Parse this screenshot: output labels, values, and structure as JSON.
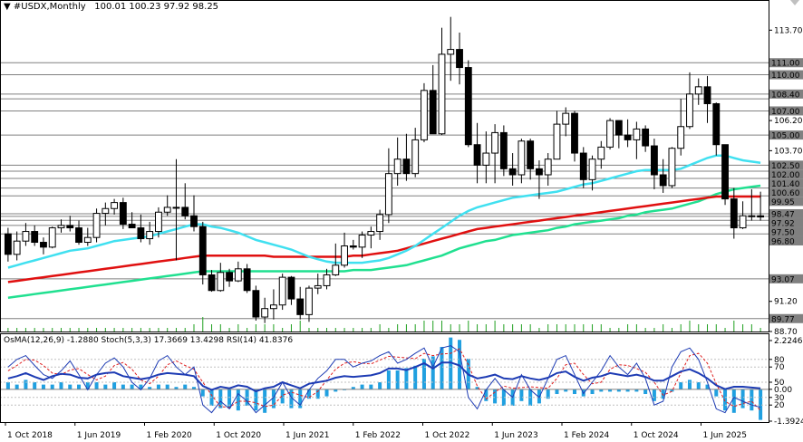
{
  "header": {
    "symbol": "#USDX,Monthly",
    "ohlc": "100.01 100.23 97.92 98.25"
  },
  "indicator_header": "OsMA(12,26,9) -1.2880  Stoch(5,3,3) 17.3669 13.4298  RSI(14) 41.8376",
  "colors": {
    "bull": "#000000",
    "bear": "#000000",
    "ma_fast": "#40e0f0",
    "ma_mid": "#20e090",
    "ma_slow": "#e01010",
    "volume": "#20a020",
    "osma": "#20a0e0",
    "stoch_main": "#1e3cb4",
    "stoch_signal": "#e02020",
    "rsi": "#1e3cb4",
    "level_line": "#808080",
    "tag_bg": "#808080",
    "tag_text": "#ffffff"
  },
  "chart_data": {
    "type": "candlestick",
    "price_axis": {
      "min": 88.7,
      "max": 115.0,
      "ticks": [
        "113.70",
        "106.20",
        "103.70",
        "96.20",
        "91.20",
        "88.70"
      ]
    },
    "price_tags": [
      "111.00",
      "110.00",
      "108.40",
      "107.00",
      "105.00",
      "102.50",
      "102.00",
      "101.40",
      "100.60",
      "99.95",
      "98.47",
      "97.92",
      "97.50",
      "96.80",
      "93.07",
      "89.77"
    ],
    "level_lines": [
      111.0,
      110.0,
      108.4,
      108.0,
      107.0,
      105.0,
      102.5,
      102.0,
      101.4,
      100.6,
      99.95,
      98.47,
      98.25,
      97.92,
      97.5,
      96.8,
      93.07,
      89.77
    ],
    "indicator_axis": {
      "ticks": [
        "2.2246",
        "80",
        "70",
        "50",
        "0.00",
        "30",
        "20",
        "-1.3924"
      ]
    },
    "x_labels": [
      "1 Oct 2018",
      "1 Jun 2019",
      "1 Feb 2020",
      "1 Oct 2020",
      "1 Jun 2021",
      "1 Feb 2022",
      "1 Oct 2022",
      "1 Jun 2023",
      "1 Feb 2024",
      "1 Oct 2024",
      "1 Jun 2025"
    ],
    "candles": [
      [
        96.8,
        97.3,
        94.5,
        95.1
      ],
      [
        95.1,
        97.0,
        94.6,
        96.2
      ],
      [
        96.2,
        97.7,
        95.8,
        97.0
      ],
      [
        97.0,
        97.5,
        95.8,
        96.1
      ],
      [
        96.1,
        96.5,
        95.1,
        95.7
      ],
      [
        95.7,
        97.4,
        95.6,
        97.3
      ],
      [
        97.3,
        98.0,
        96.9,
        97.5
      ],
      [
        97.5,
        98.3,
        97.0,
        97.3
      ],
      [
        97.3,
        97.9,
        95.9,
        96.1
      ],
      [
        96.1,
        97.3,
        95.8,
        96.5
      ],
      [
        96.5,
        98.9,
        96.1,
        98.5
      ],
      [
        98.5,
        99.4,
        97.5,
        98.9
      ],
      [
        98.9,
        99.7,
        98.4,
        99.4
      ],
      [
        99.4,
        99.8,
        97.2,
        97.6
      ],
      [
        97.6,
        98.6,
        97.4,
        97.3
      ],
      [
        97.3,
        98.4,
        96.1,
        96.4
      ],
      [
        96.4,
        97.8,
        95.9,
        97.0
      ],
      [
        97.0,
        99.0,
        96.5,
        98.6
      ],
      [
        98.6,
        100.0,
        98.3,
        99.0
      ],
      [
        99.0,
        103.0,
        94.6,
        99.0
      ],
      [
        99.0,
        101.0,
        98.0,
        98.3
      ],
      [
        98.3,
        100.0,
        97.0,
        97.4
      ],
      [
        97.4,
        97.8,
        92.6,
        93.4
      ],
      [
        93.4,
        93.8,
        92.0,
        92.1
      ],
      [
        92.1,
        94.4,
        92.0,
        93.6
      ],
      [
        93.6,
        93.9,
        92.4,
        92.9
      ],
      [
        92.9,
        94.5,
        92.8,
        93.9
      ],
      [
        93.9,
        94.3,
        91.9,
        92.1
      ],
      [
        92.1,
        92.5,
        89.6,
        89.9
      ],
      [
        89.9,
        91.5,
        89.4,
        90.6
      ],
      [
        90.6,
        92.2,
        89.7,
        90.9
      ],
      [
        90.9,
        93.5,
        90.5,
        93.2
      ],
      [
        93.2,
        93.3,
        90.9,
        91.4
      ],
      [
        91.4,
        92.4,
        89.7,
        90.1
      ],
      [
        90.1,
        92.5,
        89.5,
        92.3
      ],
      [
        92.3,
        93.5,
        91.8,
        92.5
      ],
      [
        92.5,
        93.9,
        92.2,
        93.4
      ],
      [
        93.4,
        96.0,
        93.3,
        94.2
      ],
      [
        94.2,
        96.9,
        94.0,
        95.8
      ],
      [
        95.8,
        96.3,
        95.5,
        95.7
      ],
      [
        95.7,
        97.0,
        94.8,
        96.7
      ],
      [
        96.7,
        97.4,
        95.6,
        97.0
      ],
      [
        97.0,
        98.8,
        96.3,
        98.4
      ],
      [
        98.4,
        103.9,
        97.7,
        101.8
      ],
      [
        101.8,
        104.8,
        100.8,
        103.0
      ],
      [
        103.0,
        105.1,
        101.2,
        101.8
      ],
      [
        101.8,
        105.6,
        101.5,
        104.6
      ],
      [
        104.6,
        109.3,
        104.4,
        108.7
      ],
      [
        108.7,
        110.8,
        105.5,
        105.1
      ],
      [
        105.1,
        113.9,
        105.0,
        111.7
      ],
      [
        111.7,
        114.8,
        109.5,
        112.1
      ],
      [
        112.1,
        113.5,
        109.2,
        110.6
      ],
      [
        110.6,
        111.2,
        104.0,
        104.2
      ],
      [
        104.2,
        106.0,
        101.0,
        102.5
      ],
      [
        102.5,
        105.3,
        101.0,
        103.5
      ],
      [
        103.5,
        105.9,
        101.0,
        105.2
      ],
      [
        105.2,
        105.8,
        101.6,
        102.2
      ],
      [
        102.2,
        103.5,
        100.8,
        101.7
      ],
      [
        101.7,
        104.7,
        101.0,
        104.5
      ],
      [
        104.5,
        104.7,
        101.3,
        102.2
      ],
      [
        102.2,
        102.9,
        99.7,
        101.7
      ],
      [
        101.7,
        103.5,
        100.8,
        103.0
      ],
      [
        103.0,
        107.0,
        103.0,
        105.9
      ],
      [
        105.9,
        107.3,
        104.9,
        106.8
      ],
      [
        106.8,
        107.0,
        102.8,
        103.5
      ],
      [
        103.5,
        104.0,
        100.6,
        101.3
      ],
      [
        101.3,
        103.3,
        100.4,
        103.0
      ],
      [
        103.0,
        104.5,
        102.2,
        104.0
      ],
      [
        104.0,
        106.4,
        103.8,
        106.2
      ],
      [
        106.2,
        106.0,
        103.9,
        105.0
      ],
      [
        105.0,
        106.3,
        104.0,
        104.6
      ],
      [
        104.6,
        106.1,
        103.0,
        105.5
      ],
      [
        105.5,
        105.8,
        103.6,
        104.1
      ],
      [
        104.1,
        104.7,
        100.5,
        101.7
      ],
      [
        101.7,
        103.0,
        100.2,
        100.8
      ],
      [
        100.8,
        104.0,
        100.6,
        103.9
      ],
      [
        103.9,
        108.0,
        103.3,
        105.7
      ],
      [
        105.7,
        110.2,
        105.5,
        108.4
      ],
      [
        108.4,
        109.7,
        107.5,
        109.0
      ],
      [
        109.0,
        109.9,
        106.0,
        107.6
      ],
      [
        107.6,
        107.7,
        103.3,
        104.2
      ],
      [
        104.2,
        104.2,
        99.2,
        99.7
      ],
      [
        99.7,
        100.6,
        96.4,
        97.3
      ],
      [
        97.3,
        99.5,
        97.2,
        98.3
      ],
      [
        98.3,
        100.5,
        97.9,
        98.3
      ],
      [
        98.3,
        100.3,
        97.9,
        98.2
      ]
    ],
    "ma_fast": [
      94.0,
      94.2,
      94.4,
      94.6,
      94.8,
      95.0,
      95.2,
      95.4,
      95.5,
      95.6,
      95.8,
      96.0,
      96.2,
      96.3,
      96.4,
      96.5,
      96.6,
      96.8,
      97.0,
      97.2,
      97.4,
      97.6,
      97.6,
      97.4,
      97.3,
      97.1,
      96.9,
      96.6,
      96.3,
      96.1,
      95.9,
      95.7,
      95.5,
      95.2,
      94.9,
      94.7,
      94.5,
      94.4,
      94.4,
      94.4,
      94.4,
      94.5,
      94.6,
      94.8,
      95.1,
      95.4,
      95.8,
      96.3,
      96.8,
      97.3,
      97.8,
      98.3,
      98.7,
      99.0,
      99.2,
      99.4,
      99.6,
      99.8,
      99.9,
      100.0,
      100.1,
      100.2,
      100.3,
      100.5,
      100.7,
      100.9,
      101.0,
      101.2,
      101.4,
      101.6,
      101.8,
      102.0,
      102.1,
      102.1,
      102.1,
      102.1,
      102.2,
      102.5,
      102.8,
      103.1,
      103.3,
      103.3,
      103.1,
      102.9,
      102.8,
      102.7
    ],
    "ma_mid": [
      91.5,
      91.6,
      91.7,
      91.8,
      91.9,
      92.0,
      92.1,
      92.2,
      92.3,
      92.4,
      92.5,
      92.6,
      92.7,
      92.8,
      92.9,
      93.0,
      93.1,
      93.2,
      93.3,
      93.4,
      93.5,
      93.6,
      93.7,
      93.7,
      93.7,
      93.7,
      93.7,
      93.7,
      93.7,
      93.7,
      93.7,
      93.7,
      93.7,
      93.7,
      93.7,
      93.7,
      93.7,
      93.7,
      93.7,
      93.8,
      93.8,
      93.8,
      93.9,
      94.0,
      94.1,
      94.2,
      94.4,
      94.6,
      94.8,
      95.0,
      95.3,
      95.6,
      95.8,
      96.0,
      96.2,
      96.3,
      96.5,
      96.7,
      96.8,
      96.9,
      97.0,
      97.1,
      97.3,
      97.4,
      97.6,
      97.7,
      97.8,
      97.9,
      98.0,
      98.1,
      98.3,
      98.4,
      98.6,
      98.7,
      98.8,
      98.9,
      99.1,
      99.3,
      99.5,
      99.8,
      100.1,
      100.3,
      100.5,
      100.6,
      100.7,
      100.8
    ],
    "ma_slow": [
      92.8,
      92.9,
      93.0,
      93.1,
      93.2,
      93.3,
      93.4,
      93.5,
      93.6,
      93.7,
      93.8,
      93.9,
      94.0,
      94.1,
      94.2,
      94.3,
      94.4,
      94.5,
      94.6,
      94.7,
      94.8,
      94.9,
      95.0,
      95.0,
      95.0,
      95.0,
      95.0,
      95.0,
      95.0,
      95.0,
      94.9,
      94.9,
      94.9,
      94.9,
      94.9,
      94.9,
      94.9,
      94.9,
      94.9,
      95.0,
      95.0,
      95.1,
      95.2,
      95.3,
      95.4,
      95.6,
      95.8,
      96.0,
      96.2,
      96.4,
      96.6,
      96.8,
      97.0,
      97.2,
      97.3,
      97.4,
      97.5,
      97.6,
      97.7,
      97.8,
      97.9,
      98.0,
      98.1,
      98.2,
      98.3,
      98.4,
      98.5,
      98.6,
      98.7,
      98.8,
      98.9,
      99.0,
      99.1,
      99.2,
      99.3,
      99.4,
      99.5,
      99.6,
      99.7,
      99.8,
      99.9,
      99.9,
      99.9,
      99.9,
      99.9,
      99.9
    ],
    "volume": [
      1,
      1,
      1,
      1,
      1,
      1,
      1,
      1,
      1,
      1,
      1,
      1,
      1,
      1,
      1,
      1,
      1,
      1,
      1,
      1,
      1,
      2,
      4,
      2,
      2,
      1,
      2,
      1,
      2,
      2,
      2,
      1,
      2,
      3,
      1,
      1,
      1,
      1,
      1,
      1,
      1,
      1,
      2,
      1,
      2,
      2,
      2,
      3,
      3,
      3,
      2,
      2,
      3,
      2,
      2,
      3,
      2,
      2,
      2,
      2,
      1,
      2,
      2,
      2,
      2,
      2,
      2,
      2,
      1,
      1,
      2,
      2,
      1,
      1,
      2,
      1,
      2,
      3,
      2,
      2,
      2,
      1,
      3,
      2,
      2,
      1
    ],
    "osma": [
      0.3,
      0.2,
      0.4,
      0.3,
      0.2,
      0.2,
      0.3,
      0.2,
      0.2,
      0.3,
      0.3,
      0.2,
      0.3,
      0.2,
      0.2,
      0.2,
      0.1,
      0.2,
      0.2,
      0.1,
      0.2,
      0.1,
      -0.3,
      -0.7,
      -0.8,
      -0.8,
      -0.9,
      -0.7,
      -0.9,
      -1.0,
      -0.8,
      -0.6,
      -0.8,
      -0.8,
      -0.4,
      -0.4,
      -0.3,
      -0.1,
      0.0,
      0.1,
      0.2,
      0.2,
      0.3,
      0.8,
      0.8,
      0.9,
      1.0,
      1.3,
      1.4,
      1.8,
      2.2,
      2.1,
      1.3,
      0.1,
      -0.5,
      -0.6,
      -0.7,
      -0.7,
      -0.5,
      -0.7,
      -0.6,
      -0.4,
      -0.2,
      -0.1,
      -0.2,
      -0.3,
      -0.2,
      -0.1,
      -0.1,
      -0.1,
      -0.1,
      -0.1,
      -0.2,
      -0.5,
      -0.4,
      -0.1,
      0.3,
      0.4,
      0.3,
      0.2,
      -0.3,
      -0.9,
      -1.0,
      -0.8,
      -0.9,
      -1.3
    ],
    "stoch_main": [
      70,
      80,
      85,
      72,
      60,
      55,
      65,
      78,
      60,
      40,
      60,
      75,
      82,
      70,
      50,
      40,
      55,
      78,
      85,
      70,
      60,
      70,
      20,
      10,
      25,
      15,
      35,
      25,
      10,
      20,
      30,
      50,
      30,
      20,
      40,
      55,
      65,
      80,
      80,
      70,
      75,
      78,
      85,
      90,
      75,
      80,
      88,
      95,
      70,
      95,
      98,
      90,
      30,
      15,
      40,
      55,
      40,
      30,
      60,
      40,
      30,
      55,
      80,
      85,
      60,
      35,
      50,
      65,
      85,
      70,
      60,
      75,
      55,
      20,
      25,
      70,
      90,
      95,
      80,
      50,
      15,
      10,
      30,
      25,
      20,
      17
    ],
    "stoch_signal": [
      65,
      72,
      80,
      79,
      72,
      62,
      60,
      66,
      68,
      60,
      53,
      58,
      72,
      76,
      67,
      53,
      48,
      58,
      73,
      78,
      72,
      67,
      50,
      33,
      18,
      17,
      25,
      25,
      23,
      18,
      20,
      33,
      37,
      33,
      30,
      38,
      53,
      67,
      75,
      77,
      75,
      74,
      79,
      84,
      83,
      82,
      81,
      88,
      85,
      87,
      88,
      94,
      73,
      45,
      28,
      37,
      45,
      42,
      43,
      44,
      43,
      42,
      55,
      73,
      75,
      60,
      48,
      50,
      67,
      73,
      72,
      68,
      63,
      50,
      33,
      38,
      62,
      85,
      88,
      75,
      48,
      25,
      18,
      22,
      25,
      13
    ],
    "rsi": [
      55,
      58,
      62,
      57,
      53,
      58,
      61,
      60,
      56,
      55,
      60,
      62,
      63,
      58,
      56,
      54,
      56,
      60,
      62,
      61,
      60,
      58,
      45,
      40,
      44,
      42,
      46,
      44,
      38,
      42,
      44,
      50,
      46,
      42,
      48,
      50,
      52,
      56,
      58,
      57,
      58,
      59,
      62,
      68,
      68,
      66,
      70,
      75,
      68,
      76,
      76,
      72,
      60,
      55,
      57,
      60,
      55,
      54,
      58,
      55,
      53,
      56,
      62,
      64,
      57,
      52,
      56,
      58,
      62,
      60,
      58,
      60,
      57,
      52,
      52,
      58,
      64,
      67,
      62,
      55,
      46,
      41,
      44,
      44,
      43,
      42
    ]
  }
}
